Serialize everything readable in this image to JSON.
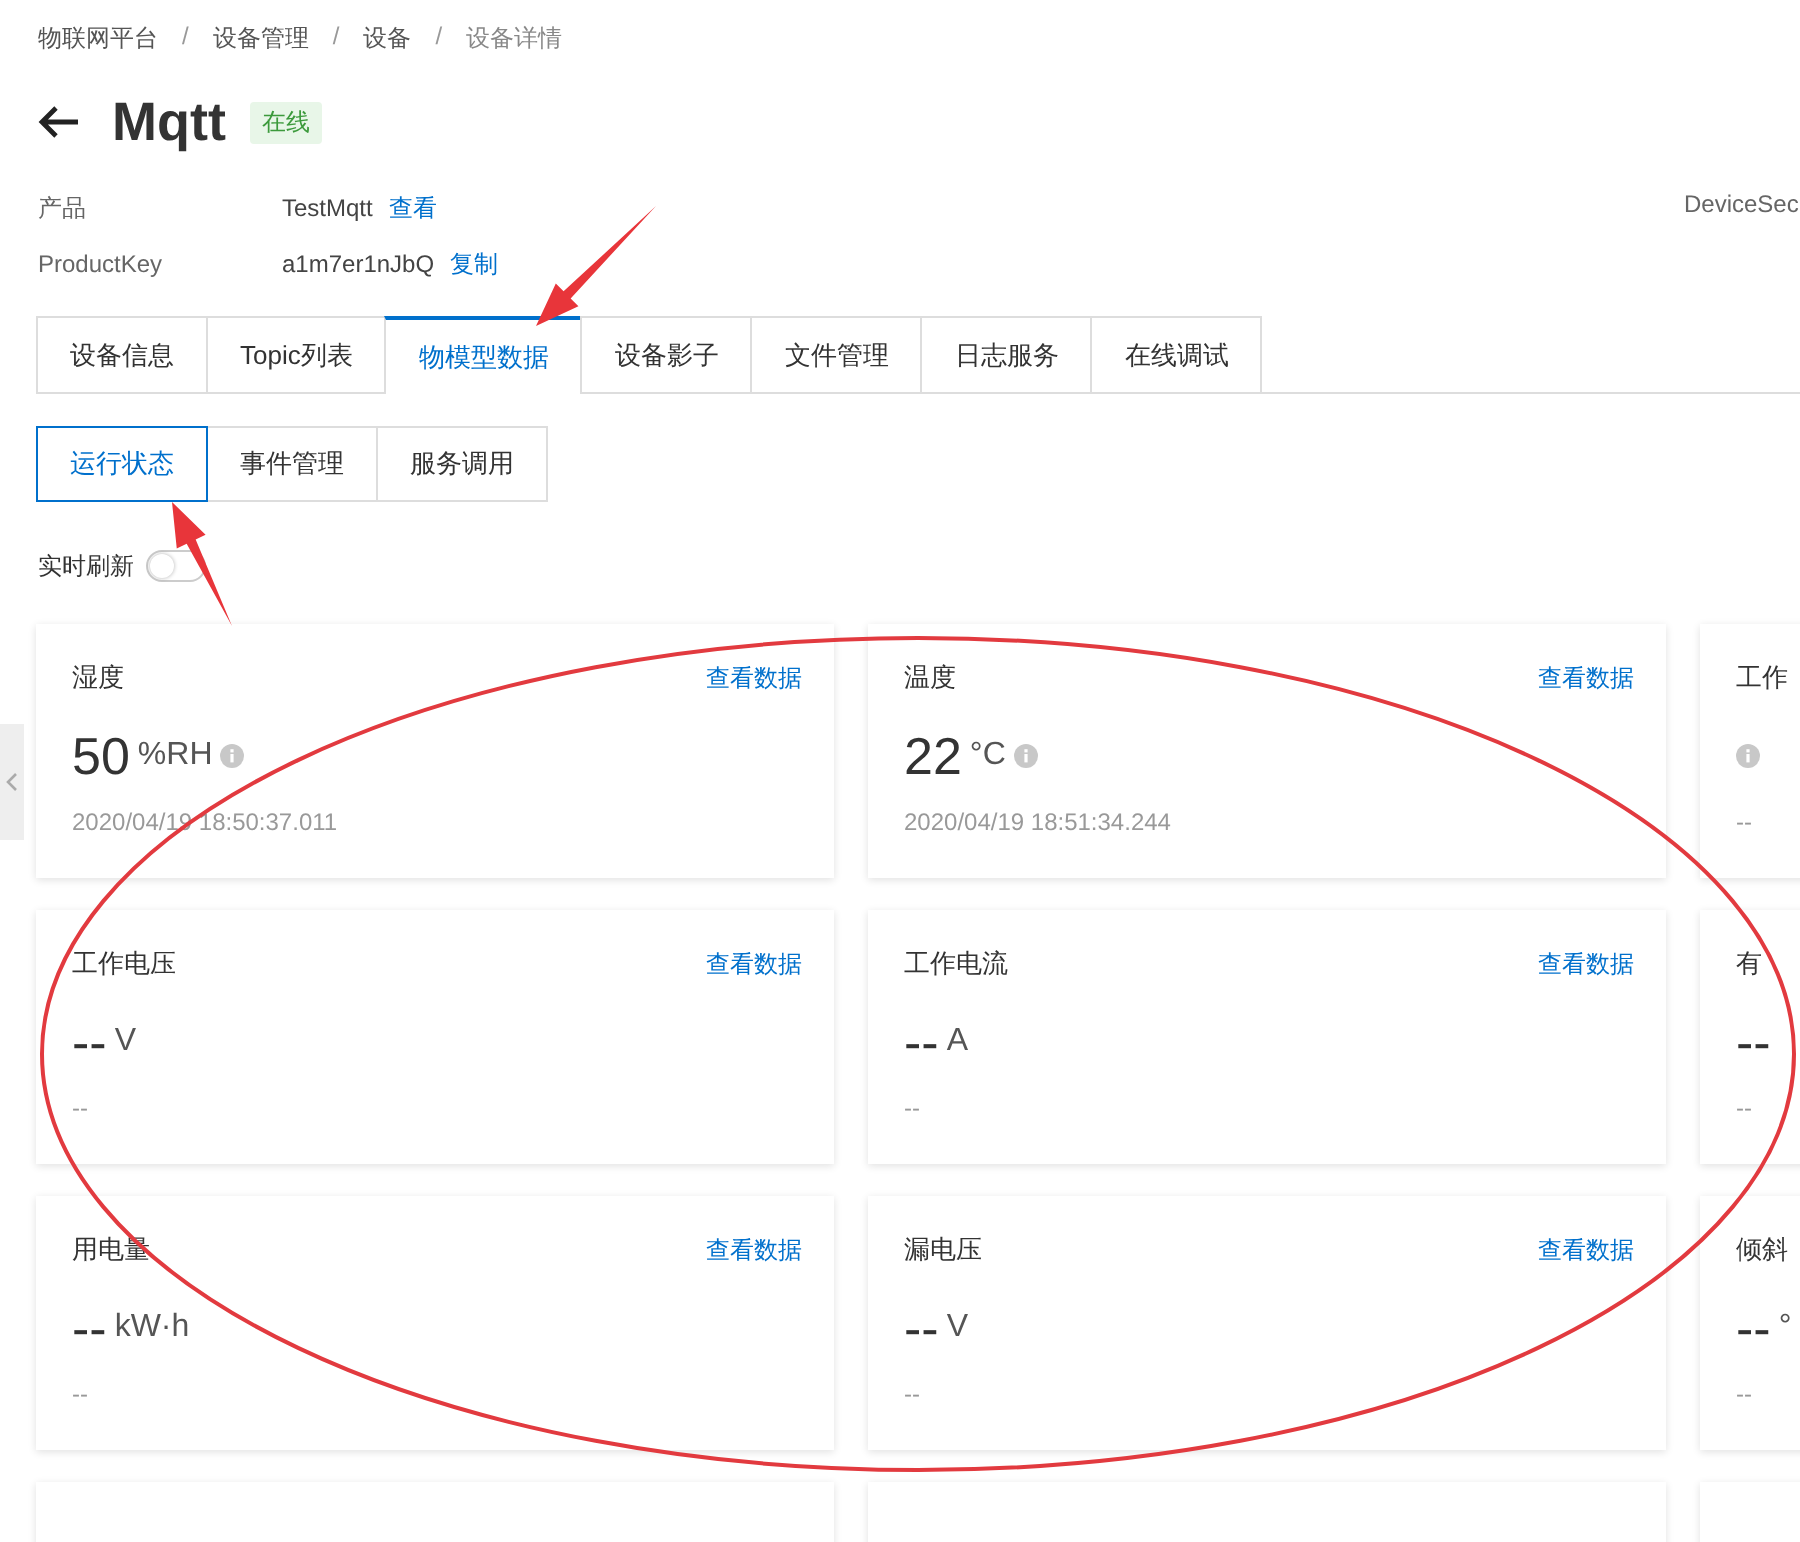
{
  "breadcrumb": [
    "物联网平台",
    "设备管理",
    "设备",
    "设备详情"
  ],
  "breadcrumb_separators": [
    "/",
    "/",
    "/"
  ],
  "title": "Mqtt",
  "status_tag": "在线",
  "info": [
    {
      "label": "产品",
      "value": "TestMqtt",
      "link": "查看"
    },
    {
      "label": "ProductKey",
      "value": "a1m7er1nJbQ",
      "link": "复制"
    }
  ],
  "info_right_label": "DeviceSec",
  "tabs": [
    {
      "label": "设备信息",
      "selected": false
    },
    {
      "label": "Topic列表",
      "selected": false
    },
    {
      "label": "物模型数据",
      "selected": true
    },
    {
      "label": "设备影子",
      "selected": false
    },
    {
      "label": "文件管理",
      "selected": false
    },
    {
      "label": "日志服务",
      "selected": false
    },
    {
      "label": "在线调试",
      "selected": false
    }
  ],
  "subtabs": [
    {
      "label": "运行状态",
      "selected": true
    },
    {
      "label": "事件管理",
      "selected": false
    },
    {
      "label": "服务调用",
      "selected": false
    }
  ],
  "auto_refresh": {
    "label": "实时刷新",
    "on": false
  },
  "cards": [
    {
      "title": "湿度",
      "link": "查看数据",
      "value": "50",
      "unit": "%RH",
      "info_icon": true,
      "time": "2020/04/19 18:50:37.011"
    },
    {
      "title": "温度",
      "link": "查看数据",
      "value": "22",
      "unit": "°C",
      "info_icon": true,
      "time": "2020/04/19 18:51:34.244"
    },
    {
      "title": "工作",
      "info_icon": true,
      "time": "--"
    },
    {
      "title": "工作电压",
      "link": "查看数据",
      "value": "--",
      "unit": "V",
      "info_icon": false,
      "time": "--"
    },
    {
      "title": "工作电流",
      "link": "查看数据",
      "value": "--",
      "unit": "A",
      "info_icon": false,
      "time": "--"
    },
    {
      "title": "有",
      "value": "--",
      "info_icon": false,
      "time": "--"
    },
    {
      "title": "用电量",
      "link": "查看数据",
      "value": "--",
      "unit": "kW·h",
      "info_icon": false,
      "time": "--"
    },
    {
      "title": "漏电压",
      "link": "查看数据",
      "value": "--",
      "unit": "V",
      "info_icon": false,
      "time": "--"
    },
    {
      "title": "倾斜",
      "value": "--",
      "unit": "°",
      "info_icon": false,
      "time": "--"
    },
    {
      "info_icon": false
    },
    {
      "info_icon": false
    },
    {
      "info_icon": false
    }
  ],
  "annotations": [
    {
      "kind": "arrow"
    },
    {
      "kind": "arrow"
    },
    {
      "kind": "ellipse"
    }
  ]
}
